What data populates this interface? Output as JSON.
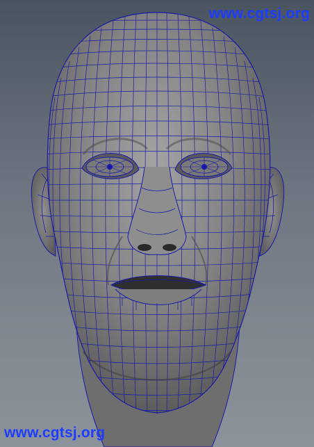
{
  "viewport": {
    "watermark_top": "www.cgtsj.org",
    "watermark_bottom": "www.cgtsj.org"
  },
  "colors": {
    "background_top": "#4a5460",
    "background_bottom": "#8c939a",
    "head_shade": "#6b6b6b",
    "head_light": "#9a9a9a",
    "wireframe": "#1a1aa8",
    "watermark": "#1e3cff"
  }
}
